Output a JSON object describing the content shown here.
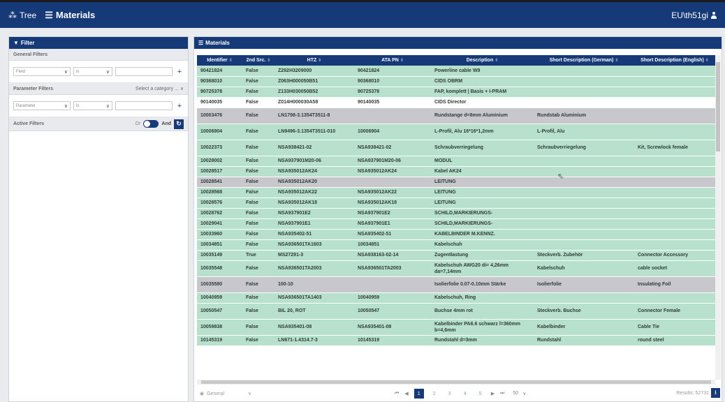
{
  "topbar": {
    "tree_label": "Tree",
    "materials_label": "Materials",
    "user": "EU\\th51gi"
  },
  "filter": {
    "title": "Filter",
    "general_filters": "General Filters",
    "field_placeholder": "Field",
    "op_placeholder": "is",
    "parameter_filters": "Parameter Filters",
    "select_category": "Select a category ...",
    "parameter_placeholder": "Parameter",
    "active_filters": "Active Filters",
    "or_label": "Or",
    "and_label": "And"
  },
  "materials": {
    "title": "Materials",
    "columns": [
      "Identifier",
      "2nd Src.",
      "HTZ",
      "ATA PN",
      "Description",
      "Short Description (German)",
      "Short Description (English)"
    ],
    "rows": [
      {
        "c": "g",
        "v": [
          "90421824",
          "False",
          "Z292H3209000",
          "90421824",
          "Powerline cable W9",
          "",
          ""
        ]
      },
      {
        "c": "g",
        "v": [
          "90368010",
          "False",
          "Z063H000050B51",
          "90368010",
          "CIDS OBRM",
          "",
          ""
        ]
      },
      {
        "c": "g",
        "v": [
          "90725378",
          "False",
          "Z133H030050B52",
          "90725378",
          "FAP, komplett | Basis + I-PRAM",
          "",
          ""
        ]
      },
      {
        "c": "w",
        "v": [
          "90140035",
          "False",
          "Z014H000030A58",
          "90140035",
          "CIDS Director",
          "",
          ""
        ]
      },
      {
        "c": "gr",
        "h": 23,
        "v": [
          "10003476",
          "False",
          "LN1798-3.1354T3511-8",
          "",
          "Rundstange d=8mm Aluminium",
          "Rundstab Aluminium",
          ""
        ]
      },
      {
        "c": "g",
        "h": 23,
        "v": [
          "10006904",
          "False",
          "LN9496-3.1354T3511-010",
          "10006904",
          "L-Profil, Alu 16*16*1,2mm",
          "L-Profil, Alu",
          ""
        ]
      },
      {
        "c": "g",
        "h": 23,
        "v": [
          "10022373",
          "False",
          "NSA938421-02",
          "NSA938421-02",
          "Schraubverriegelung",
          "Schraubverriegelung",
          "Kit, Screwlock female"
        ]
      },
      {
        "c": "g",
        "v": [
          "10028002",
          "False",
          "NSA937901M20-06",
          "NSA937901M20-06",
          "MODUL",
          "",
          ""
        ]
      },
      {
        "c": "g",
        "v": [
          "10028517",
          "False",
          "NSA935012AK24",
          "NSA935012AK24",
          "Kabel AK24",
          "",
          ""
        ]
      },
      {
        "c": "gr",
        "v": [
          "10028541",
          "False",
          "NSA935012AK20",
          "",
          "LEITUNG",
          "",
          ""
        ]
      },
      {
        "c": "g",
        "v": [
          "10028568",
          "False",
          "NSA935012AK22",
          "NSA935012AK22",
          "LEITUNG",
          "",
          ""
        ]
      },
      {
        "c": "g",
        "v": [
          "10028576",
          "False",
          "NSA935012AK18",
          "NSA935012AK18",
          "LEITUNG",
          "",
          ""
        ]
      },
      {
        "c": "g",
        "v": [
          "10028762",
          "False",
          "NSA937901E2",
          "NSA937901E2",
          "SCHILD,MARKIERUNGS-",
          "",
          ""
        ]
      },
      {
        "c": "g",
        "v": [
          "10029041",
          "False",
          "NSA937901E1",
          "NSA937901E1",
          "SCHILD,MARKIERUNGS-",
          "",
          ""
        ]
      },
      {
        "c": "g",
        "v": [
          "10033960",
          "False",
          "NSA935402-51",
          "NSA935402-51",
          "KABELBINDER M.KENNZ.",
          "",
          ""
        ]
      },
      {
        "c": "g",
        "v": [
          "10034851",
          "False",
          "NSA936501TA1603",
          "10034851",
          "Kabelschuh",
          "",
          ""
        ]
      },
      {
        "c": "g",
        "v": [
          "10035149",
          "True",
          "MS27291-3",
          "NSA938163-02-14",
          "Zugentlastung",
          "Steckverb. Zubehör",
          "Connector Accessory"
        ]
      },
      {
        "c": "g",
        "h": 23,
        "v": [
          "10035548",
          "False",
          "NSA936501TA2003",
          "NSA936501TA2003",
          "Kabelschuh AWG20 di= 4,26mm da=7,14mm",
          "Kabelschuh",
          "cable socket"
        ]
      },
      {
        "c": "gr",
        "h": 23,
        "v": [
          "10035580",
          "False",
          "100-10",
          "",
          "Isolierfolie 0.07-0.10mm Stärke",
          "Isolierfolie",
          "Insulating Foil"
        ]
      },
      {
        "c": "g",
        "v": [
          "10040959",
          "False",
          "NSA936501TA1403",
          "10040959",
          "Kabelschuh, Ring",
          "",
          ""
        ]
      },
      {
        "c": "g",
        "h": 23,
        "v": [
          "10050547",
          "False",
          "BIL 20, ROT",
          "10050547",
          "Buchse 4mm rot",
          "Steckverb. Buchse",
          "Connector Female"
        ]
      },
      {
        "c": "g",
        "h": 23,
        "v": [
          "10059838",
          "False",
          "NSA935401-08",
          "NSA935401-08",
          "Kabelbinder PA6.6 schwarz l=360mm b=4,6mm",
          "Kabelbinder",
          "Cable Tie"
        ]
      },
      {
        "c": "g",
        "v": [
          "10145319",
          "False",
          "LN671-1.4314.7-3",
          "10145319",
          "Rundstahl d=3mm",
          "Rundstahl",
          "round steel"
        ]
      }
    ]
  },
  "footer": {
    "view_label": "General",
    "pages": [
      "1",
      "2",
      "3",
      "4",
      "5"
    ],
    "page_size": "50",
    "results": "Results: 52731"
  },
  "colors": {
    "primary": "#163a78",
    "row_green": "#b7e1cd",
    "row_gray": "#c8c8cc"
  }
}
